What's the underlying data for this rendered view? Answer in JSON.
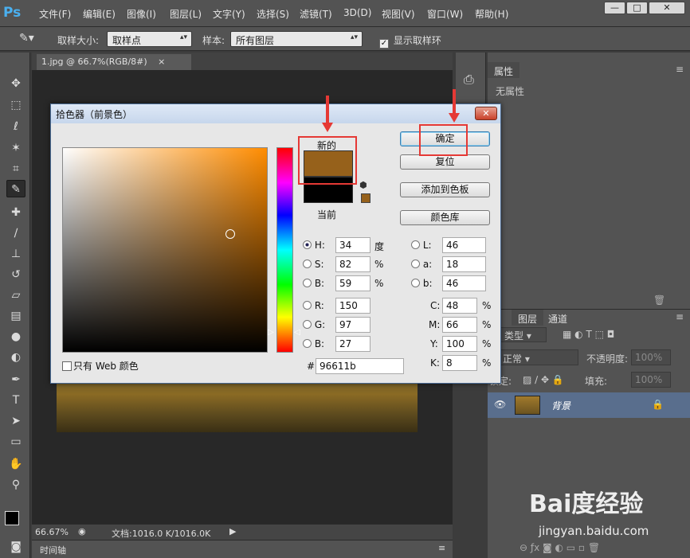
{
  "app": {
    "logo": "Ps"
  },
  "menu": [
    "文件(F)",
    "编辑(E)",
    "图像(I)",
    "图层(L)",
    "文字(Y)",
    "选择(S)",
    "滤镜(T)",
    "3D(D)",
    "视图(V)",
    "窗口(W)",
    "帮助(H)"
  ],
  "window_buttons": [
    "—",
    "□",
    "✕"
  ],
  "options": {
    "sample_size_label": "取样大小:",
    "sample_size_value": "取样点",
    "sample_label": "样本:",
    "sample_value": "所有图层",
    "show_ring_label": "显示取样环"
  },
  "document": {
    "tab_title": "1.jpg @ 66.7%(RGB/8#)",
    "tab_close": "×",
    "zoom": "66.67%",
    "doc_info": "文档:1016.0 K/1016.0K",
    "timeline_label": "时间轴"
  },
  "properties": {
    "tab": "属性",
    "empty_text": "无属性"
  },
  "layers": {
    "tabs": [
      "图层",
      "通道"
    ],
    "filter_kind": "类型",
    "blend_mode": "正常",
    "opacity_label": "不透明度:",
    "opacity_value": "100%",
    "lock_label": "锁定:",
    "fill_label": "填充:",
    "fill_value": "100%",
    "layer_name": "背景"
  },
  "picker": {
    "title": "拾色器（前景色）",
    "close": "✕",
    "new_label": "新的",
    "current_label": "当前",
    "new_color": "#96611b",
    "current_color": "#000000",
    "buttons": {
      "ok": "确定",
      "reset": "复位",
      "add_swatch": "添加到色板",
      "libraries": "颜色库"
    },
    "web_only_label": "只有 Web 颜色",
    "hsb": {
      "h": "34",
      "h_unit": "度",
      "s": "82",
      "s_unit": "%",
      "b": "59",
      "b_unit": "%"
    },
    "rgb": {
      "r": "150",
      "g": "97",
      "b": "27"
    },
    "lab": {
      "l": "46",
      "a": "18",
      "b": "46"
    },
    "cmyk": {
      "c": "48",
      "m": "66",
      "y": "100",
      "k": "8"
    },
    "hex": "96611b",
    "labels": {
      "H": "H:",
      "S": "S:",
      "B": "B:",
      "R": "R:",
      "G": "G:",
      "Bb": "B:",
      "L": "L:",
      "a": "a:",
      "lb": "b:",
      "C": "C:",
      "M": "M:",
      "Y": "Y:",
      "K": "K:",
      "hash": "#",
      "pct": "%"
    }
  },
  "watermark": {
    "brand": "Bai度经验",
    "url": "jingyan.baidu.com"
  }
}
